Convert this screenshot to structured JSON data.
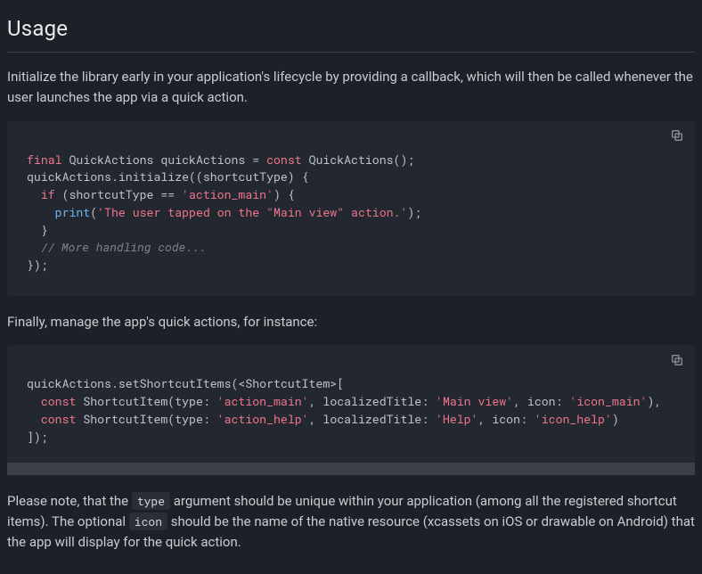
{
  "heading": "Usage",
  "intro": "Initialize the library early in your application's lifecycle by providing a callback, which will then be called whenever the user launches the app via a quick action.",
  "code1": {
    "tokens": [
      {
        "t": "final",
        "c": "kw"
      },
      {
        "t": " QuickActions quickActions = "
      },
      {
        "t": "const",
        "c": "kw"
      },
      {
        "t": " QuickActions();\n"
      },
      {
        "t": "quickActions.initialize((shortcutType) {\n"
      },
      {
        "t": "  "
      },
      {
        "t": "if",
        "c": "kw"
      },
      {
        "t": " (shortcutType == "
      },
      {
        "t": "'action_main'",
        "c": "str"
      },
      {
        "t": ") {\n"
      },
      {
        "t": "    "
      },
      {
        "t": "print",
        "c": "fn"
      },
      {
        "t": "("
      },
      {
        "t": "'The user tapped on the \"Main view\" action.'",
        "c": "str"
      },
      {
        "t": ");\n"
      },
      {
        "t": "  }\n"
      },
      {
        "t": "  "
      },
      {
        "t": "// More handling code...",
        "c": "com"
      },
      {
        "t": "\n"
      },
      {
        "t": "});"
      }
    ]
  },
  "middle": "Finally, manage the app's quick actions, for instance:",
  "code2": {
    "tokens": [
      {
        "t": "quickActions.setShortcutItems(<ShortcutItem>[\n"
      },
      {
        "t": "  "
      },
      {
        "t": "const",
        "c": "kw"
      },
      {
        "t": " ShortcutItem(type: "
      },
      {
        "t": "'action_main'",
        "c": "str"
      },
      {
        "t": ", localizedTitle: "
      },
      {
        "t": "'Main view'",
        "c": "str"
      },
      {
        "t": ", icon: "
      },
      {
        "t": "'icon_main'",
        "c": "str"
      },
      {
        "t": "),\n"
      },
      {
        "t": "  "
      },
      {
        "t": "const",
        "c": "kw"
      },
      {
        "t": " ShortcutItem(type: "
      },
      {
        "t": "'action_help'",
        "c": "str"
      },
      {
        "t": ", localizedTitle: "
      },
      {
        "t": "'Help'",
        "c": "str"
      },
      {
        "t": ", icon: "
      },
      {
        "t": "'icon_help'",
        "c": "str"
      },
      {
        "t": ")\n"
      },
      {
        "t": "]);"
      }
    ]
  },
  "note_pre": "Please note, that the ",
  "note_type": "type",
  "note_mid": " argument should be unique within your application (among all the registered shortcut items). The optional ",
  "note_icon": "icon",
  "note_post": " should be the name of the native resource (xcassets on iOS or drawable on Android) that the app will display for the quick action."
}
